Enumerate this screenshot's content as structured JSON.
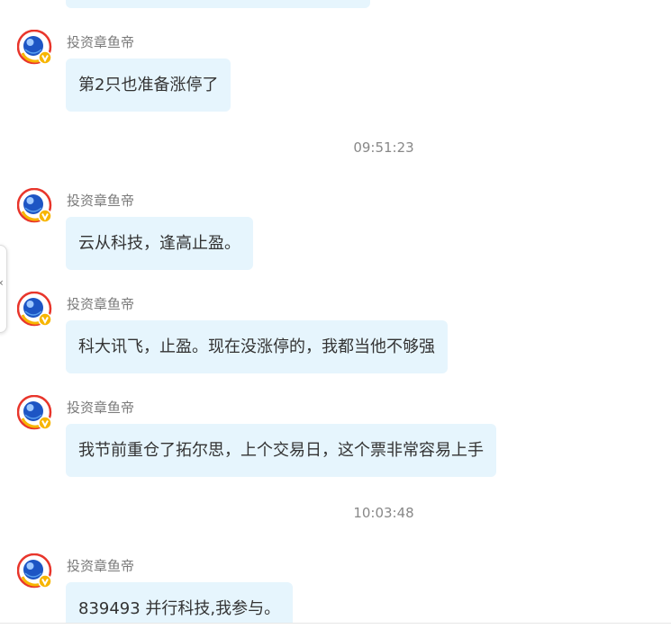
{
  "chat": {
    "messages": [
      {
        "sender": "投资章鱼帝",
        "text": "第2只也准备涨停了"
      },
      {
        "sender": "投资章鱼帝",
        "text": "云从科技，逢高止盈。"
      },
      {
        "sender": "投资章鱼帝",
        "text": "科大讯飞，止盈。现在没涨停的，我都当他不够强"
      },
      {
        "sender": "投资章鱼帝",
        "text": "我节前重仓了拓尔思，上个交易日，这个票非常容易上手"
      },
      {
        "sender": "投资章鱼帝",
        "text": "839493 并行科技,我参与。"
      }
    ],
    "timestamps": [
      "09:51:23",
      "10:03:48"
    ]
  },
  "side_handle": {
    "glyph": "‹"
  },
  "colors": {
    "bubble_bg": "#e6f5fd",
    "sender_text": "#7a7a7a",
    "message_text": "#333333",
    "timestamp_text": "#888888",
    "avatar_ring": "#e8352b",
    "avatar_globe": "#1d55c4",
    "avatar_badge": "#f7b500"
  },
  "icons": {
    "avatar": "globe-avatar-icon",
    "verified_badge": "verified-v-badge-icon",
    "side_handle": "chevron-left-icon"
  }
}
